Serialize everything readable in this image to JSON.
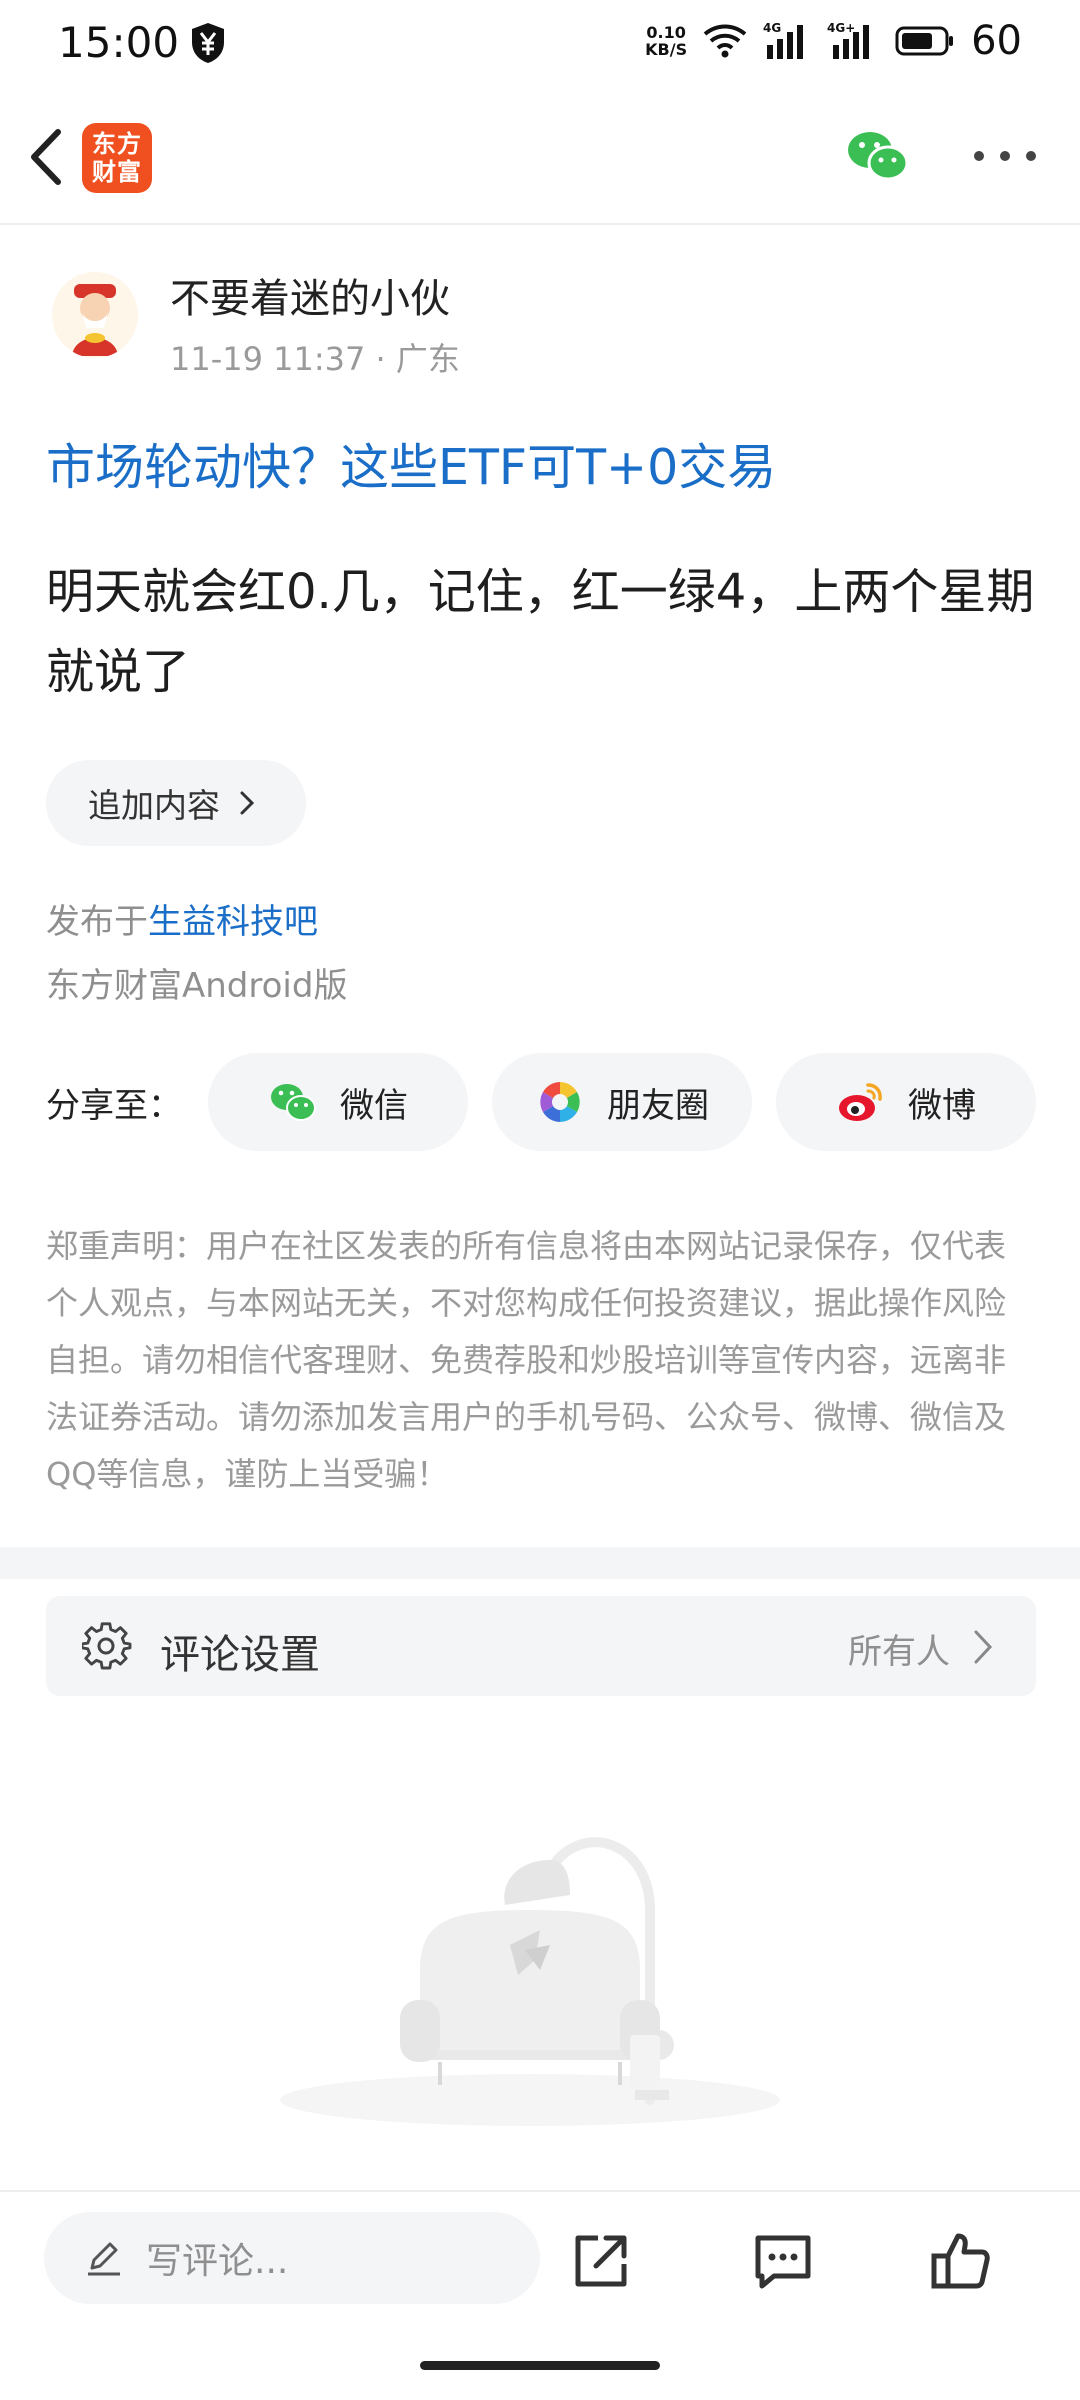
{
  "status_bar": {
    "time": "15:00",
    "net_speed_value": "0.10",
    "net_speed_unit": "KB/S",
    "battery": "60"
  },
  "header": {
    "logo_line1": "东方",
    "logo_line2": "财富",
    "icons": [
      "back-icon",
      "wechat-icon",
      "more-icon"
    ]
  },
  "post": {
    "author": "不要着迷的小伙",
    "datetime": "11-19 11:37",
    "location": "· 广东",
    "title": "市场轮动快？这些ETF可T+0交易",
    "body": "明天就会红0.几，记住，红一绿4，上两个星期就说了",
    "append_label": "追加内容",
    "published_prefix": "发布于",
    "published_bar": "生益科技吧",
    "client": "东方财富Android版"
  },
  "share": {
    "label": "分享至：",
    "targets": [
      {
        "label": "微信",
        "icon": "wechat-icon"
      },
      {
        "label": "朋友圈",
        "icon": "moments-icon"
      },
      {
        "label": "微博",
        "icon": "weibo-icon"
      }
    ]
  },
  "disclaimer": "郑重声明：用户在社区发表的所有信息将由本网站记录保存，仅代表个人观点，与本网站无关，不对您构成任何投资建议，据此操作风险自担。请勿相信代客理财、免费荐股和炒股培训等宣传内容，远离非法证券活动。请勿添加发言用户的手机号码、公众号、微博、微信及QQ等信息，谨防上当受骗！",
  "comment_settings": {
    "label": "评论设置",
    "value": "所有人"
  },
  "bottom_bar": {
    "input_placeholder": "写评论...",
    "icons": [
      "share-icon",
      "comment-icon",
      "like-icon"
    ]
  },
  "colors": {
    "link_blue": "#1a6ec8",
    "brand_orange": "#f0501f",
    "pill_bg": "#f4f5f7",
    "wechat_green": "#3bbf55"
  }
}
